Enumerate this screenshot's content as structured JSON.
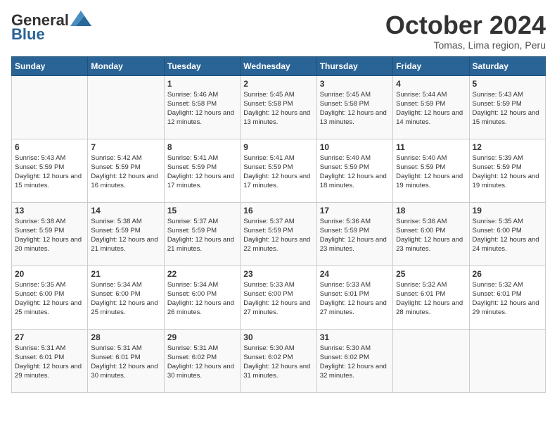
{
  "header": {
    "logo_line1": "General",
    "logo_line2": "Blue",
    "month_title": "October 2024",
    "location": "Tomas, Lima region, Peru"
  },
  "weekdays": [
    "Sunday",
    "Monday",
    "Tuesday",
    "Wednesday",
    "Thursday",
    "Friday",
    "Saturday"
  ],
  "weeks": [
    [
      {
        "day": "",
        "info": ""
      },
      {
        "day": "",
        "info": ""
      },
      {
        "day": "1",
        "info": "Sunrise: 5:46 AM\nSunset: 5:58 PM\nDaylight: 12 hours and 12 minutes."
      },
      {
        "day": "2",
        "info": "Sunrise: 5:45 AM\nSunset: 5:58 PM\nDaylight: 12 hours and 13 minutes."
      },
      {
        "day": "3",
        "info": "Sunrise: 5:45 AM\nSunset: 5:58 PM\nDaylight: 12 hours and 13 minutes."
      },
      {
        "day": "4",
        "info": "Sunrise: 5:44 AM\nSunset: 5:59 PM\nDaylight: 12 hours and 14 minutes."
      },
      {
        "day": "5",
        "info": "Sunrise: 5:43 AM\nSunset: 5:59 PM\nDaylight: 12 hours and 15 minutes."
      }
    ],
    [
      {
        "day": "6",
        "info": "Sunrise: 5:43 AM\nSunset: 5:59 PM\nDaylight: 12 hours and 15 minutes."
      },
      {
        "day": "7",
        "info": "Sunrise: 5:42 AM\nSunset: 5:59 PM\nDaylight: 12 hours and 16 minutes."
      },
      {
        "day": "8",
        "info": "Sunrise: 5:41 AM\nSunset: 5:59 PM\nDaylight: 12 hours and 17 minutes."
      },
      {
        "day": "9",
        "info": "Sunrise: 5:41 AM\nSunset: 5:59 PM\nDaylight: 12 hours and 17 minutes."
      },
      {
        "day": "10",
        "info": "Sunrise: 5:40 AM\nSunset: 5:59 PM\nDaylight: 12 hours and 18 minutes."
      },
      {
        "day": "11",
        "info": "Sunrise: 5:40 AM\nSunset: 5:59 PM\nDaylight: 12 hours and 19 minutes."
      },
      {
        "day": "12",
        "info": "Sunrise: 5:39 AM\nSunset: 5:59 PM\nDaylight: 12 hours and 19 minutes."
      }
    ],
    [
      {
        "day": "13",
        "info": "Sunrise: 5:38 AM\nSunset: 5:59 PM\nDaylight: 12 hours and 20 minutes."
      },
      {
        "day": "14",
        "info": "Sunrise: 5:38 AM\nSunset: 5:59 PM\nDaylight: 12 hours and 21 minutes."
      },
      {
        "day": "15",
        "info": "Sunrise: 5:37 AM\nSunset: 5:59 PM\nDaylight: 12 hours and 21 minutes."
      },
      {
        "day": "16",
        "info": "Sunrise: 5:37 AM\nSunset: 5:59 PM\nDaylight: 12 hours and 22 minutes."
      },
      {
        "day": "17",
        "info": "Sunrise: 5:36 AM\nSunset: 5:59 PM\nDaylight: 12 hours and 23 minutes."
      },
      {
        "day": "18",
        "info": "Sunrise: 5:36 AM\nSunset: 6:00 PM\nDaylight: 12 hours and 23 minutes."
      },
      {
        "day": "19",
        "info": "Sunrise: 5:35 AM\nSunset: 6:00 PM\nDaylight: 12 hours and 24 minutes."
      }
    ],
    [
      {
        "day": "20",
        "info": "Sunrise: 5:35 AM\nSunset: 6:00 PM\nDaylight: 12 hours and 25 minutes."
      },
      {
        "day": "21",
        "info": "Sunrise: 5:34 AM\nSunset: 6:00 PM\nDaylight: 12 hours and 25 minutes."
      },
      {
        "day": "22",
        "info": "Sunrise: 5:34 AM\nSunset: 6:00 PM\nDaylight: 12 hours and 26 minutes."
      },
      {
        "day": "23",
        "info": "Sunrise: 5:33 AM\nSunset: 6:00 PM\nDaylight: 12 hours and 27 minutes."
      },
      {
        "day": "24",
        "info": "Sunrise: 5:33 AM\nSunset: 6:01 PM\nDaylight: 12 hours and 27 minutes."
      },
      {
        "day": "25",
        "info": "Sunrise: 5:32 AM\nSunset: 6:01 PM\nDaylight: 12 hours and 28 minutes."
      },
      {
        "day": "26",
        "info": "Sunrise: 5:32 AM\nSunset: 6:01 PM\nDaylight: 12 hours and 29 minutes."
      }
    ],
    [
      {
        "day": "27",
        "info": "Sunrise: 5:31 AM\nSunset: 6:01 PM\nDaylight: 12 hours and 29 minutes."
      },
      {
        "day": "28",
        "info": "Sunrise: 5:31 AM\nSunset: 6:01 PM\nDaylight: 12 hours and 30 minutes."
      },
      {
        "day": "29",
        "info": "Sunrise: 5:31 AM\nSunset: 6:02 PM\nDaylight: 12 hours and 30 minutes."
      },
      {
        "day": "30",
        "info": "Sunrise: 5:30 AM\nSunset: 6:02 PM\nDaylight: 12 hours and 31 minutes."
      },
      {
        "day": "31",
        "info": "Sunrise: 5:30 AM\nSunset: 6:02 PM\nDaylight: 12 hours and 32 minutes."
      },
      {
        "day": "",
        "info": ""
      },
      {
        "day": "",
        "info": ""
      }
    ]
  ]
}
